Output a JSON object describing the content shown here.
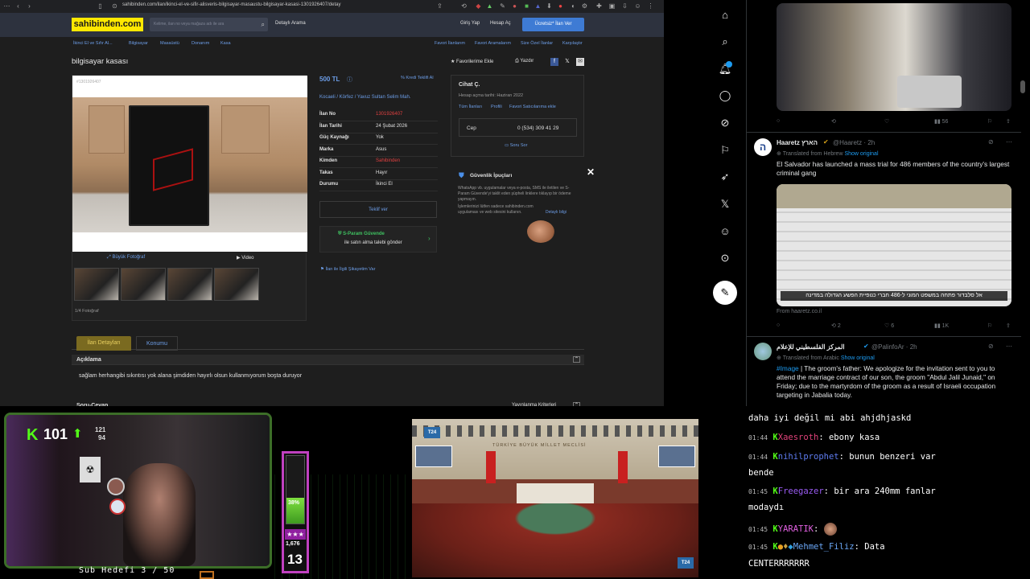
{
  "browser": {
    "url": "sahibinden.com/ilan/ikinci-el-ve-sifir-alisveris-bilgisayar-masaustu-bilgisayar-kasasi-1301926407/detay"
  },
  "site": {
    "logo": "sahibinden.com",
    "search_placeholder": "Kelime, ilan no veya mağaza adı ile ara",
    "detailed_search": "Detaylı Arama",
    "login": "Giriş Yap",
    "signup": "Hesap Aç",
    "post_ad": "Ücretsiz* İlan Ver",
    "breadcrumb": [
      "İkinci El ve Sıfır Al...",
      "Bilgisayar",
      "Masaüstü",
      "Donanım",
      "Kasa"
    ],
    "sub_links": [
      "Favori İlanlarım",
      "Favori Aramalarım",
      "Size Özel İlanlar",
      "Karşılaştır"
    ],
    "title": "bilgisayar kasası",
    "add_favorites": "Favorilerime Ekle",
    "print": "Yazdır",
    "ad_number_watermark": "#1301926407",
    "big_photo": "Büyük Fotoğraf",
    "video": "Video",
    "photo_count": "1/4 Fotoğraf",
    "price": "500 TL",
    "credit_offer": "Kredi Teklifi Al",
    "location": "Kocaeli  /  Körfez  /  Yavuz Sultan Selim Mah.",
    "details": [
      {
        "label": "İlan No",
        "value": "1301926407",
        "red": true
      },
      {
        "label": "İlan Tarihi",
        "value": "24 Şubat 2026",
        "red": false
      },
      {
        "label": "Güç Kaynağı",
        "value": "Yok",
        "red": false
      },
      {
        "label": "Marka",
        "value": "Asus",
        "red": false
      },
      {
        "label": "Kimden",
        "value": "Sahibinden",
        "red": true
      },
      {
        "label": "Takas",
        "value": "Hayır",
        "red": false
      },
      {
        "label": "Durumu",
        "value": "İkinci El",
        "red": false
      }
    ],
    "make_offer": "Teklif ver",
    "sparam_title": "S-Param Güvende",
    "sparam_sub": "ile satın alma talebi gönder",
    "complaint": "İlan ile İlgili Şikayetim Var",
    "seller_name": "Cihat Ç.",
    "account_date": "Hesap açma tarihi: Haziran 2022",
    "seller_links": [
      "Tüm İlanları",
      "Profili",
      "Favori Satıcılarıma ekle"
    ],
    "phone_label": "Cep",
    "phone": "0 (534) 309 41 29",
    "ask_question": "Soru Sor",
    "safety_title": "Güvenlik İpuçları",
    "safety_text1": "WhatsApp vb. uygulamalar veya e-posta, SMS ile iletilen ve S-Param Güvende'yi taklit eden şüpheli linklere tıklayıp bir ödeme yapmayın.",
    "safety_text2": "İşlemlerinizi lütfen sadece sahibinden.com uygulaması ve web sitesini kullanın.",
    "safety_more": "Detaylı bilgi",
    "tab_details": "İlan Detayları",
    "tab_location": "Konumu",
    "section_desc": "Açıklama",
    "description": "sağlam herhangibi sıkıntısı yok alana şimdiden hayırlı olsun kullanmıyorum boşta duruyor",
    "section_qa": "Soru-Cevap",
    "qa_link": "Yayınlanma Kriterleri"
  },
  "twitter": {
    "tweet1_actions": {
      "views": "56"
    },
    "tweet2": {
      "name": "Haaretz הארץ",
      "handle": "@Haaretz · 2h",
      "translated": "Translated from Hebrew",
      "show_original": "Show original",
      "text": "El Salvador has launched a mass trial for 486 members of the country's largest criminal gang",
      "caption": "אל סלבדור פתחה במשפט המוני ל-486 חברי כנופיית הפשע הגדולה במדינה",
      "source": "From haaretz.co.il",
      "replies": "",
      "reposts": "2",
      "likes": "6",
      "views": "1K"
    },
    "tweet3": {
      "name": "المركز الفلسطيني للإعلام",
      "handle": "@PalinfoAr · 2h",
      "translated": "Translated from Arabic",
      "show_original": "Show original",
      "hashtag": "#Image",
      "text": " | The groom's father: We apologize for the invitation sent to you to attend the marriage contract of our son, the groom \"Abdul Jalil Junaid,\" on Friday; due to the martyrdom of the groom as a result of Israeli occupation targeting in Jabalia today."
    }
  },
  "stream": {
    "followers": "101",
    "stat1": "121",
    "stat2": "94",
    "bar_percent": "38%",
    "bar_fill_fraction": 0.38,
    "count1": "1,676",
    "count2": "13",
    "sub_goal": "Sub Hedefi  3 / 50",
    "tv_logo": "T24",
    "parliament_text": "TÜRKİYE BÜYÜK MİLLET MECLİSİ"
  },
  "chat": [
    {
      "time": "",
      "user": "",
      "msg": "daha iyi değil mi abi ahjdhjaskd"
    },
    {
      "time": "01:44",
      "user": "Xaesroth",
      "msg": "ebony kasa"
    },
    {
      "time": "01:44",
      "user": "nihilprophet",
      "msg": "bunun benzeri var"
    },
    {
      "time": "",
      "user": "",
      "msg": "bende"
    },
    {
      "time": "01:45",
      "user": "Freegazer",
      "msg": "bir ara 240mm fanlar"
    },
    {
      "time": "",
      "user": "",
      "msg": "modaydı"
    },
    {
      "time": "01:45",
      "user": "YARATIK",
      "msg": ""
    },
    {
      "time": "01:45",
      "user": "Mehmet_Filiz",
      "msg": "Data"
    },
    {
      "time": "",
      "user": "",
      "msg": "CENTERRRRRRR"
    }
  ]
}
